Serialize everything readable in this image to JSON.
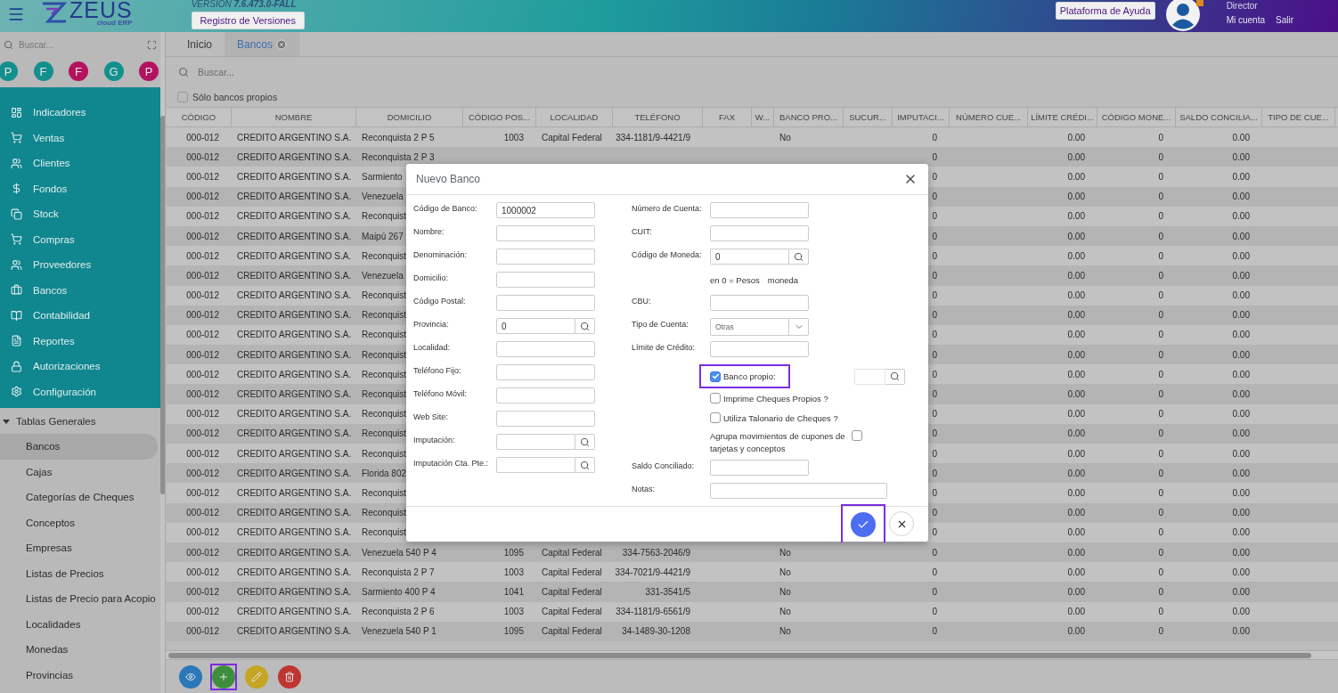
{
  "header": {
    "logo": {
      "name": "ZEUS",
      "tagline": "cloud ERP"
    },
    "version_prefix": "VERSION",
    "version": "7.6.473.0-FALL",
    "versions_button": "Registro de Versiones",
    "help_button": "Plataforma de Ayuda",
    "user": {
      "role": "Director",
      "links": [
        "Mi cuenta",
        "Salir"
      ],
      "notification": true
    }
  },
  "sidebar": {
    "search_placeholder": "Buscar...",
    "avatars": [
      {
        "letter": "P",
        "color": "#13908d"
      },
      {
        "letter": "F",
        "color": "#13908d"
      },
      {
        "letter": "F",
        "color": "#b3125f"
      },
      {
        "letter": "G",
        "color": "#13908d"
      },
      {
        "letter": "P",
        "color": "#b3125f"
      }
    ],
    "menu": [
      "Indicadores",
      "Ventas",
      "Clientes",
      "Fondos",
      "Stock",
      "Compras",
      "Proveedores",
      "Bancos",
      "Contabilidad",
      "Reportes",
      "Autorizaciones",
      "Configuración"
    ],
    "group": {
      "label": "Tablas Generales",
      "expanded": true,
      "children": [
        {
          "label": "Bancos",
          "selected": true
        },
        {
          "label": "Cajas",
          "selected": false
        },
        {
          "label": "Categorías de Cheques",
          "selected": false
        },
        {
          "label": "Conceptos",
          "selected": false
        },
        {
          "label": "Empresas",
          "selected": false
        },
        {
          "label": "Listas de Precios",
          "selected": false
        },
        {
          "label": "Listas de Precio para Acopio",
          "selected": false
        },
        {
          "label": "Localidades",
          "selected": false
        },
        {
          "label": "Monedas",
          "selected": false
        },
        {
          "label": "Provincias",
          "selected": false
        }
      ]
    }
  },
  "tabs": [
    {
      "label": "Inicio",
      "selected": false
    },
    {
      "label": "Bancos",
      "selected": true,
      "closable": true
    }
  ],
  "filter": {
    "search_placeholder": "Buscar...",
    "own_banks": {
      "label": "Sólo bancos propios",
      "checked": false
    }
  },
  "table": {
    "columns": [
      "CÓDIGO",
      "NOMBRE",
      "DOMICILIO",
      "CÓDIGO POS...",
      "LOCALIDAD",
      "TELÉFONO",
      "FAX",
      "W...",
      "BANCO PRO...",
      "SUCUR...",
      "IMPUTACI...",
      "NÚMERO CUE...",
      "LÍMITE CRÉDI...",
      "CÓDIGO MONE...",
      "SALDO CONCILIA...",
      "TIPO DE CUE..."
    ],
    "rows": [
      [
        "000-012",
        "CREDITO ARGENTINO S.A.",
        "Reconquista 2 P 5",
        "1003",
        "Capital Federal",
        "334-1181/9-4421/9",
        null,
        null,
        "No",
        null,
        "0",
        null,
        "0.00",
        "0",
        "0.00",
        null
      ],
      [
        "000-012",
        "CREDITO ARGENTINO S.A.",
        "Reconquista 2 P 3",
        null,
        null,
        null,
        null,
        null,
        null,
        null,
        "0",
        null,
        "0.00",
        "0",
        "0.00",
        null
      ],
      [
        "000-012",
        "CREDITO ARGENTINO S.A.",
        "Sarmiento",
        null,
        null,
        null,
        null,
        null,
        null,
        null,
        "0",
        null,
        "0.00",
        "0",
        "0.00",
        null
      ],
      [
        "000-012",
        "CREDITO ARGENTINO S.A.",
        "Venezuela",
        null,
        null,
        null,
        null,
        null,
        null,
        null,
        "0",
        null,
        "0.00",
        "0",
        "0.00",
        null
      ],
      [
        "000-012",
        "CREDITO ARGENTINO S.A.",
        "Reconquist",
        null,
        null,
        null,
        null,
        null,
        null,
        null,
        "0",
        null,
        "0.00",
        "0",
        "0.00",
        null
      ],
      [
        "000-012",
        "CREDITO ARGENTINO S.A.",
        "Maipú 267",
        null,
        null,
        null,
        null,
        null,
        null,
        null,
        "0",
        null,
        "0.00",
        "0",
        "0.00",
        null
      ],
      [
        "000-012",
        "CREDITO ARGENTINO S.A.",
        "Reconquist",
        null,
        null,
        null,
        null,
        null,
        null,
        null,
        "0",
        null,
        "0.00",
        "0",
        "0.00",
        null
      ],
      [
        "000-012",
        "CREDITO ARGENTINO S.A.",
        "Venezuela",
        null,
        null,
        null,
        null,
        null,
        null,
        null,
        "0",
        null,
        "0.00",
        "0",
        "0.00",
        null
      ],
      [
        "000-012",
        "CREDITO ARGENTINO S.A.",
        "Reconquist",
        null,
        null,
        null,
        null,
        null,
        null,
        null,
        "0",
        null,
        "0.00",
        "0",
        "0.00",
        null
      ],
      [
        "000-012",
        "CREDITO ARGENTINO S.A.",
        "Reconquist",
        null,
        null,
        null,
        null,
        null,
        null,
        null,
        "0",
        null,
        "0.00",
        "0",
        "0.00",
        null
      ],
      [
        "000-012",
        "CREDITO ARGENTINO S.A.",
        "Reconquist",
        null,
        null,
        null,
        null,
        null,
        null,
        null,
        "0",
        null,
        "0.00",
        "0",
        "0.00",
        null
      ],
      [
        "000-012",
        "CREDITO ARGENTINO S.A.",
        "Reconquist",
        null,
        null,
        null,
        null,
        null,
        null,
        null,
        "0",
        null,
        "0.00",
        "0",
        "0.00",
        null
      ],
      [
        "000-012",
        "CREDITO ARGENTINO S.A.",
        "Reconquist",
        null,
        null,
        null,
        null,
        null,
        null,
        null,
        "0",
        null,
        "0.00",
        "0",
        "0.00",
        null
      ],
      [
        "000-012",
        "CREDITO ARGENTINO S.A.",
        "Reconquist",
        null,
        null,
        null,
        null,
        null,
        null,
        null,
        "0",
        null,
        "0.00",
        "0",
        "0.00",
        null
      ],
      [
        "000-012",
        "CREDITO ARGENTINO S.A.",
        "Reconquist",
        null,
        null,
        null,
        null,
        null,
        null,
        null,
        "0",
        null,
        "0.00",
        "0",
        "0.00",
        null
      ],
      [
        "000-012",
        "CREDITO ARGENTINO S.A.",
        "Reconquist",
        null,
        null,
        null,
        null,
        null,
        null,
        null,
        "0",
        null,
        "0.00",
        "0",
        "0.00",
        null
      ],
      [
        "000-012",
        "CREDITO ARGENTINO S.A.",
        "Reconquist",
        null,
        null,
        null,
        null,
        null,
        null,
        null,
        "0",
        null,
        "0.00",
        "0",
        "0.00",
        null
      ],
      [
        "000-012",
        "CREDITO ARGENTINO S.A.",
        "Florida 802",
        null,
        null,
        null,
        null,
        null,
        null,
        null,
        "0",
        null,
        "0.00",
        "0",
        "0.00",
        null
      ],
      [
        "000-012",
        "CREDITO ARGENTINO S.A.",
        "Reconquist",
        null,
        null,
        null,
        null,
        null,
        null,
        null,
        "0",
        null,
        "0.00",
        "0",
        "0.00",
        null
      ],
      [
        "000-012",
        "CREDITO ARGENTINO S.A.",
        "Reconquist",
        null,
        null,
        null,
        null,
        null,
        null,
        null,
        "0",
        null,
        "0.00",
        "0",
        "0.00",
        null
      ],
      [
        "000-012",
        "CREDITO ARGENTINO S.A.",
        "Reconquist",
        null,
        null,
        null,
        null,
        null,
        null,
        null,
        "0",
        null,
        "0.00",
        "0",
        "0.00",
        null
      ],
      [
        "000-012",
        "CREDITO ARGENTINO S.A.",
        "Venezuela 540 P 4",
        "1095",
        "Capital Federal",
        "334-7563-2046/9",
        null,
        null,
        "No",
        null,
        "0",
        null,
        "0.00",
        "0",
        "0.00",
        null
      ],
      [
        "000-012",
        "CREDITO ARGENTINO S.A.",
        "Reconquista 2 P 7",
        "1003",
        "Capital Federal",
        "334-7021/9-4421/9",
        null,
        null,
        "No",
        null,
        "0",
        null,
        "0.00",
        "0",
        "0.00",
        null
      ],
      [
        "000-012",
        "CREDITO ARGENTINO S.A.",
        "Sarmiento 400 P 4",
        "1041",
        "Capital Federal",
        "331-3541/5",
        null,
        null,
        "No",
        null,
        "0",
        null,
        "0.00",
        "0",
        "0.00",
        null
      ],
      [
        "000-012",
        "CREDITO ARGENTINO S.A.",
        "Reconquista 2 P 6",
        "1003",
        "Capital Federal",
        "334-1181/9-6561/9",
        null,
        null,
        "No",
        null,
        "0",
        null,
        "0.00",
        "0",
        "0.00",
        null
      ],
      [
        "000-012",
        "CREDITO ARGENTINO S.A.",
        "Venezuela 540 P 1",
        "1095",
        "Capital Federal",
        "34-1489-30-1208",
        null,
        null,
        "No",
        null,
        "0",
        null,
        "0.00",
        "0",
        "0.00",
        null
      ]
    ]
  },
  "toolbar": [
    {
      "kind": "view"
    },
    {
      "kind": "add",
      "highlighted": true
    },
    {
      "kind": "edit"
    },
    {
      "kind": "delete"
    }
  ],
  "modal": {
    "title": "Nuevo Banco",
    "left_fields": [
      {
        "kind": "text",
        "label": "Código de Banco:",
        "value": "1000002"
      },
      {
        "kind": "text",
        "label": "Nombre:"
      },
      {
        "kind": "text",
        "label": "Denominación:"
      },
      {
        "kind": "text",
        "label": "Domicilio:"
      },
      {
        "kind": "text",
        "label": "Código Postal:"
      },
      {
        "kind": "lookup",
        "label": "Provincia:",
        "value": "0"
      },
      {
        "kind": "text",
        "label": "Localidad:"
      },
      {
        "kind": "text",
        "label": "Teléfono Fijo:"
      },
      {
        "kind": "text",
        "label": "Teléfono Móvil:"
      },
      {
        "kind": "text",
        "label": "Web Site:"
      },
      {
        "kind": "lookup",
        "label": "Imputación:"
      },
      {
        "kind": "lookup",
        "label": "Imputación Cta. Pte.:"
      }
    ],
    "right_fields": [
      {
        "kind": "text",
        "label": "Número de Cuenta:"
      },
      {
        "kind": "text",
        "label": "CUIT:"
      },
      {
        "kind": "lookup",
        "label": "Código de Moneda:",
        "value": "0"
      },
      {
        "kind": "note",
        "parts": [
          "en 0 = Pesos",
          "moneda"
        ]
      },
      {
        "kind": "text",
        "label": "CBU:"
      },
      {
        "kind": "select",
        "label": "Tipo de Cuenta:",
        "value": "Otras"
      },
      {
        "kind": "text",
        "label": "Límite de Crédito:"
      },
      {
        "kind": "check",
        "label": "Banco propio:",
        "checked": true,
        "highlighted": true,
        "with_lookup": true
      },
      {
        "kind": "check",
        "label": "Imprime Cheques Propios ?",
        "checked": false
      },
      {
        "kind": "check",
        "label": "Utiliza Talonario de Cheques ?",
        "checked": false
      },
      {
        "kind": "check_after",
        "label": "Agrupa movimientos de cupones de tarjetas y conceptos",
        "checked": false
      },
      {
        "kind": "text",
        "label": "Saldo Conciliado:"
      },
      {
        "kind": "wide",
        "label": "Notas:"
      }
    ],
    "confirm": {
      "highlighted": true
    }
  }
}
